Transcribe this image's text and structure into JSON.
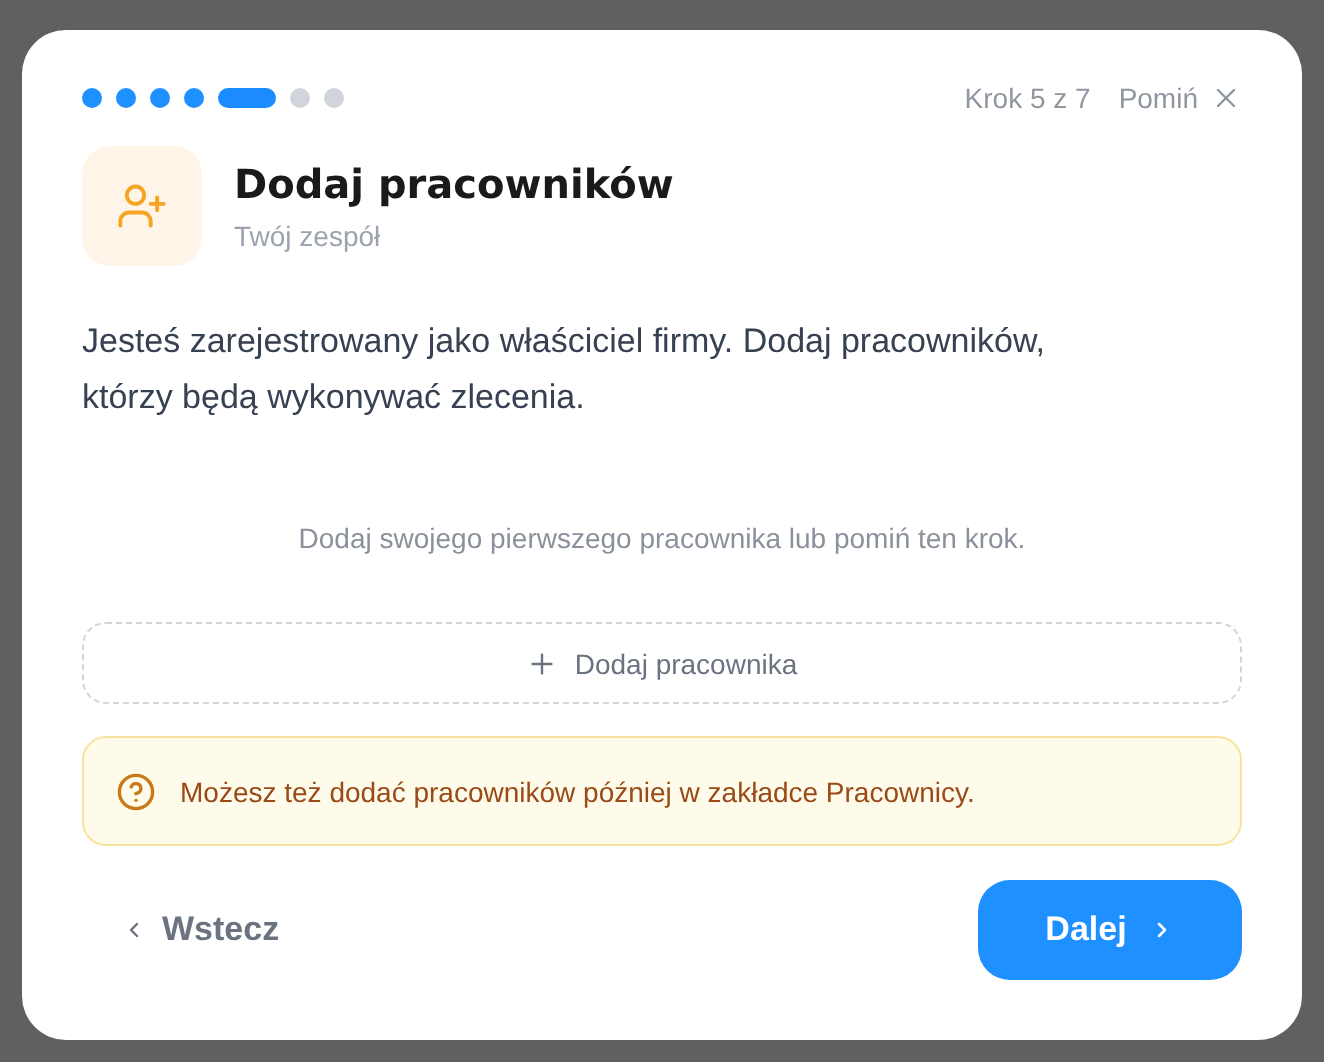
{
  "progress": {
    "steps": [
      {
        "completed": true,
        "selected": false
      },
      {
        "completed": true,
        "selected": false
      },
      {
        "completed": true,
        "selected": false
      },
      {
        "completed": true,
        "selected": false
      },
      {
        "completed": false,
        "selected": true
      },
      {
        "completed": false,
        "selected": false
      },
      {
        "completed": false,
        "selected": false
      }
    ],
    "step_label": "Krok 5 z 7",
    "skip": "Pomiń"
  },
  "header": {
    "title": "Dodaj pracowników",
    "subtitle": "Twój zespół"
  },
  "description": "Jesteś zarejestrowany jako właściciel firmy. Dodaj pracowników, którzy będą wykonywać zlecenia.",
  "empty_note": "Dodaj swojego pierwszego pracownika lub pomiń ten krok.",
  "add_button": "Dodaj pracownika",
  "info": "Możesz też dodać pracowników później w zakładce Pracownicy.",
  "footer": {
    "back": "Wstecz",
    "next": "Dalej"
  }
}
